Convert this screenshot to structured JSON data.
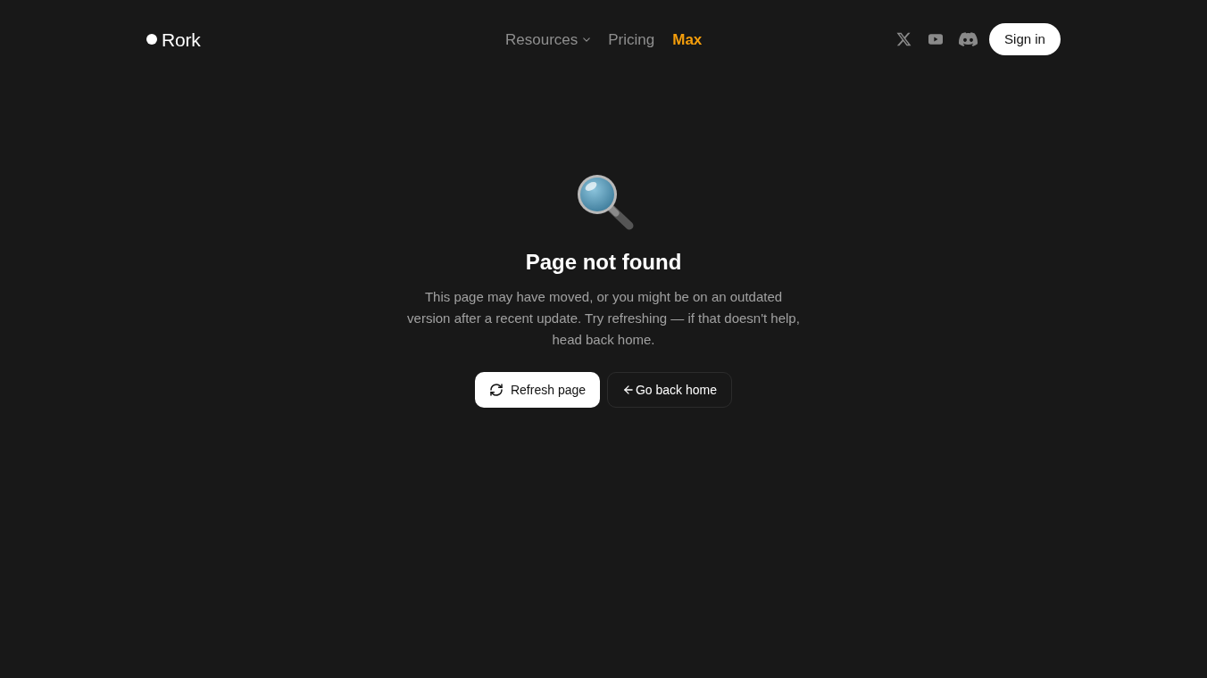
{
  "header": {
    "logo": {
      "text": "Rork"
    },
    "nav": [
      {
        "label": "Resources",
        "kind": "dropdown",
        "highlighted": false
      },
      {
        "label": "Pricing",
        "kind": "link",
        "highlighted": false
      },
      {
        "label": "Max",
        "kind": "link",
        "highlighted": true
      }
    ],
    "social_links": [
      {
        "kind": "x"
      },
      {
        "kind": "youtube"
      },
      {
        "kind": "discord"
      }
    ],
    "sign_in": {
      "label": "Sign in"
    }
  },
  "main": {
    "title": "Page not found",
    "message": "This page may have moved, or you might be on an outdated version after a recent update. Try refreshing — if that doesn't help, head back home.",
    "buttons": [
      {
        "label": "Refresh page",
        "kind": "primary"
      },
      {
        "label": "Go back home",
        "kind": "secondary"
      }
    ]
  }
}
